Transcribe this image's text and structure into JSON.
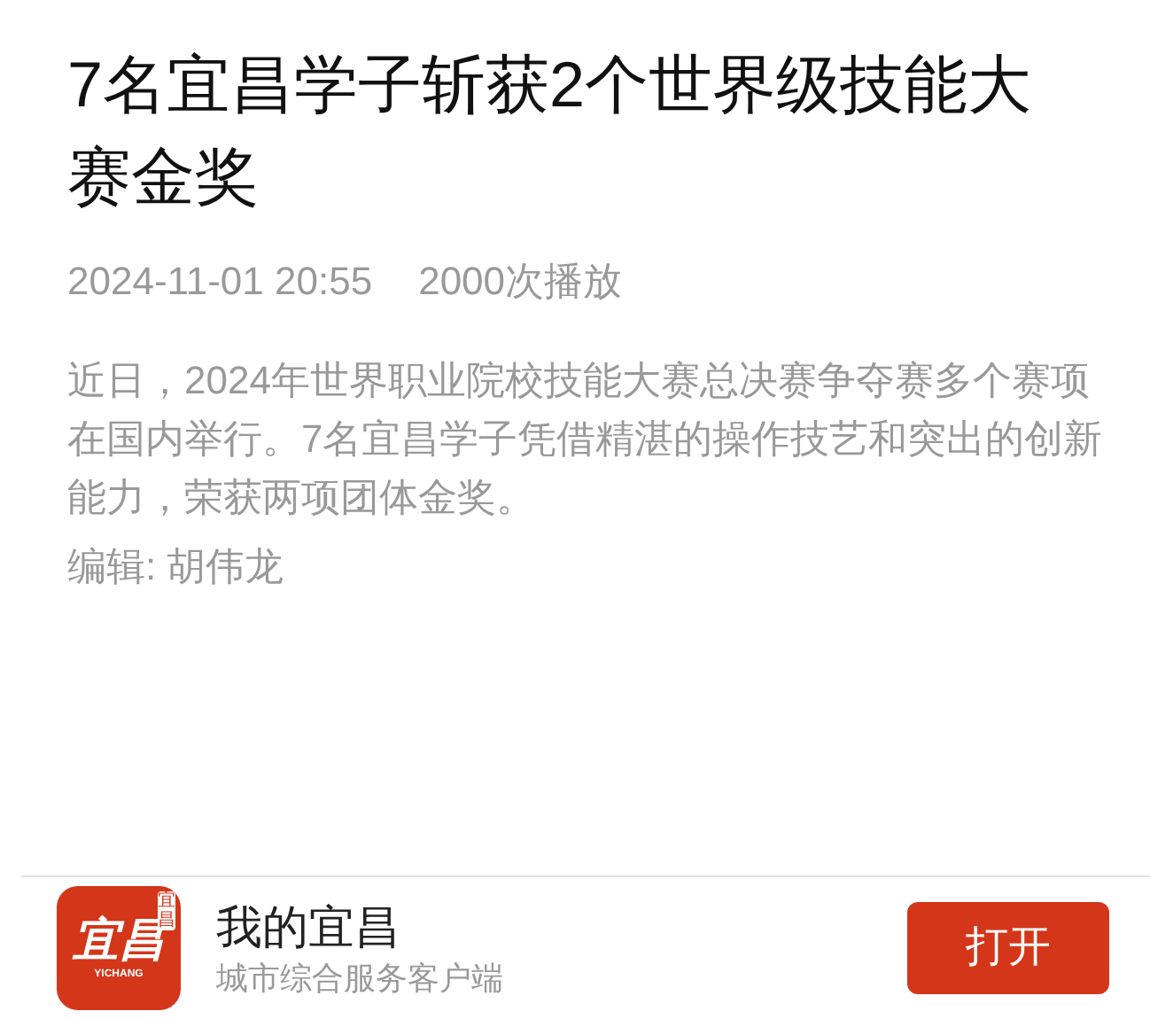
{
  "article": {
    "title": "7名宜昌学子斩获2个世界级技能大赛金奖",
    "date": "2024-11-01 20:55",
    "plays": "2000次播放",
    "summary": "近日，2024年世界职业院校技能大赛总决赛争夺赛多个赛项在国内举行。7名宜昌学子凭借精湛的操作技艺和突出的创新能力，荣获两项团体金奖。",
    "editor": "编辑: 胡伟龙"
  },
  "app_banner": {
    "logo": {
      "text": "宜昌",
      "subtext": "YICHANG",
      "seal": "宜昌"
    },
    "name": "我的宜昌",
    "tagline": "城市综合服务客户端",
    "button": "打开"
  }
}
